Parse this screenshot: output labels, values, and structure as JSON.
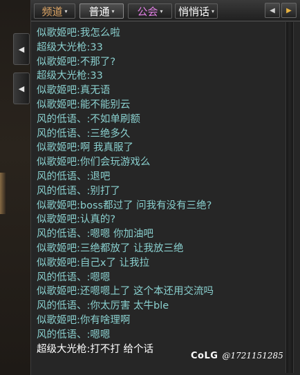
{
  "tabs": [
    {
      "label": "频道",
      "color": "#e0a766"
    },
    {
      "label": "普通",
      "color": "#ffffff"
    },
    {
      "label": "公会",
      "color": "#e07fe3"
    },
    {
      "label": "悄悄话",
      "color": "#ffffff"
    }
  ],
  "tab_arrow": "▾",
  "nav": {
    "prev": "◀",
    "next": "▶"
  },
  "side": {
    "collapse_top": "◀",
    "collapse_bottom": "◀"
  },
  "messages": [
    {
      "who": "似歌姬吧",
      "text": "我怎么啦"
    },
    {
      "who": "超级大光枪",
      "text": "33"
    },
    {
      "who": "似歌姬吧",
      "text": "不那了?"
    },
    {
      "who": "超级大光枪",
      "text": "33"
    },
    {
      "who": "似歌姬吧",
      "text": "真无语"
    },
    {
      "who": "似歌姬吧",
      "text": "能不能别云"
    },
    {
      "who": "风的低语、",
      "text": "不如单刷额"
    },
    {
      "who": "风的低语、",
      "text": "三绝多久"
    },
    {
      "who": "似歌姬吧",
      "text": "啊  我真服了"
    },
    {
      "who": "似歌姬吧",
      "text": "你们会玩游戏么"
    },
    {
      "who": "风的低语、",
      "text": "退吧"
    },
    {
      "who": "风的低语、",
      "text": "别打了"
    },
    {
      "who": "似歌姬吧",
      "text": "boss都过了  问我有没有三绝?"
    },
    {
      "who": "似歌姬吧",
      "text": "认真的?"
    },
    {
      "who": "风的低语、",
      "text": "嗯嗯  你加油吧"
    },
    {
      "who": "似歌姬吧",
      "text": "三绝都放了  让我放三绝"
    },
    {
      "who": "似歌姬吧",
      "text": "自己x了  让我拉"
    },
    {
      "who": "风的低语、",
      "text": "嗯嗯"
    },
    {
      "who": "似歌姬吧",
      "text": "还嗯嗯上了  这个本还用交流吗"
    },
    {
      "who": "风的低语、",
      "text": "你太厉害  太牛ble"
    },
    {
      "who": "似歌姬吧",
      "text": "你有啥理啊"
    },
    {
      "who": "风的低语、",
      "text": "嗯嗯"
    },
    {
      "who": "超级大光枪",
      "text": "打不打  给个话",
      "light": true
    }
  ],
  "separator": ":",
  "watermark": {
    "logo": "CoLG",
    "handle": "@1721151285"
  }
}
